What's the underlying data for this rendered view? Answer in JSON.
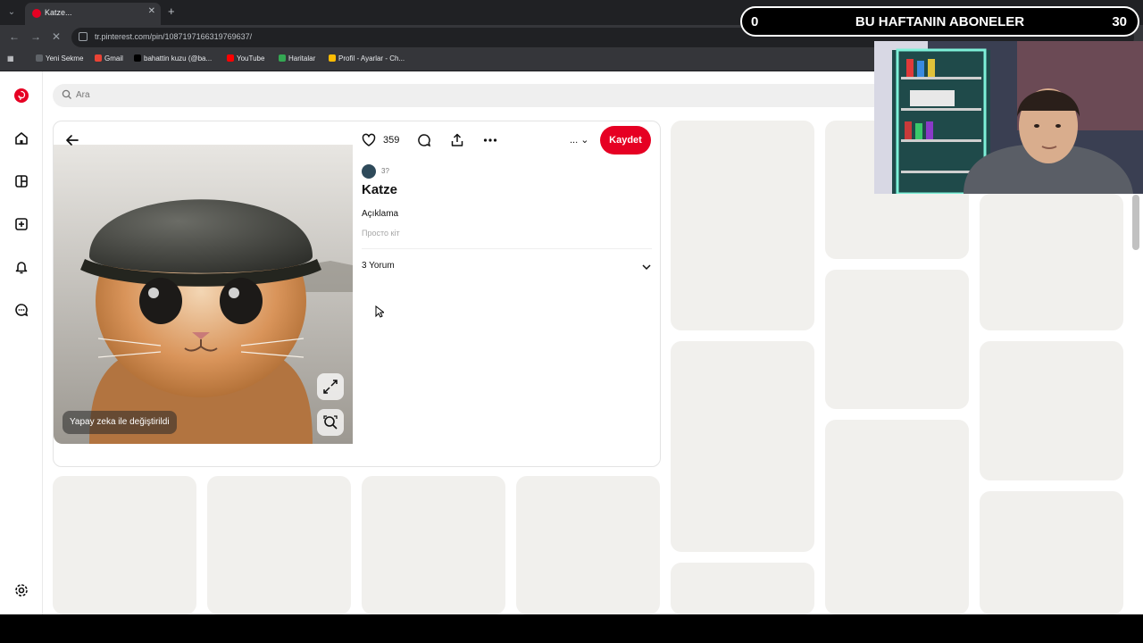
{
  "browser": {
    "tab_title": "Katze...",
    "url": "tr.pinterest.com/pin/1087197166319769637/",
    "bookmarks": [
      {
        "label": "Yeni Sekme",
        "color": "#5f6368"
      },
      {
        "label": "Gmail",
        "color": "#ea4335"
      },
      {
        "label": "bahattin kuzu (@ba...",
        "color": "#000000"
      },
      {
        "label": "YouTube",
        "color": "#ff0000"
      },
      {
        "label": "Haritalar",
        "color": "#34a853"
      },
      {
        "label": "Profil - Ayarlar - Ch...",
        "color": "#fbbc04"
      }
    ]
  },
  "search": {
    "placeholder": "Ara"
  },
  "pin": {
    "like_count": "359",
    "save_label": "Kaydet",
    "board_selector": "...",
    "author": "3?",
    "title": "Katze",
    "description_label": "Açıklama",
    "description_text": "Просто кіт",
    "comments_label": "3 Yorum",
    "ai_badge": "Yapay zeka ile değiştirildi"
  },
  "overlay": {
    "subscriber_left": "0",
    "subscriber_title": "BU HAFTANIN ABONELER",
    "subscriber_right": "30"
  },
  "colors": {
    "brand": "#e60023",
    "placeholder": "#f1f0ed"
  }
}
